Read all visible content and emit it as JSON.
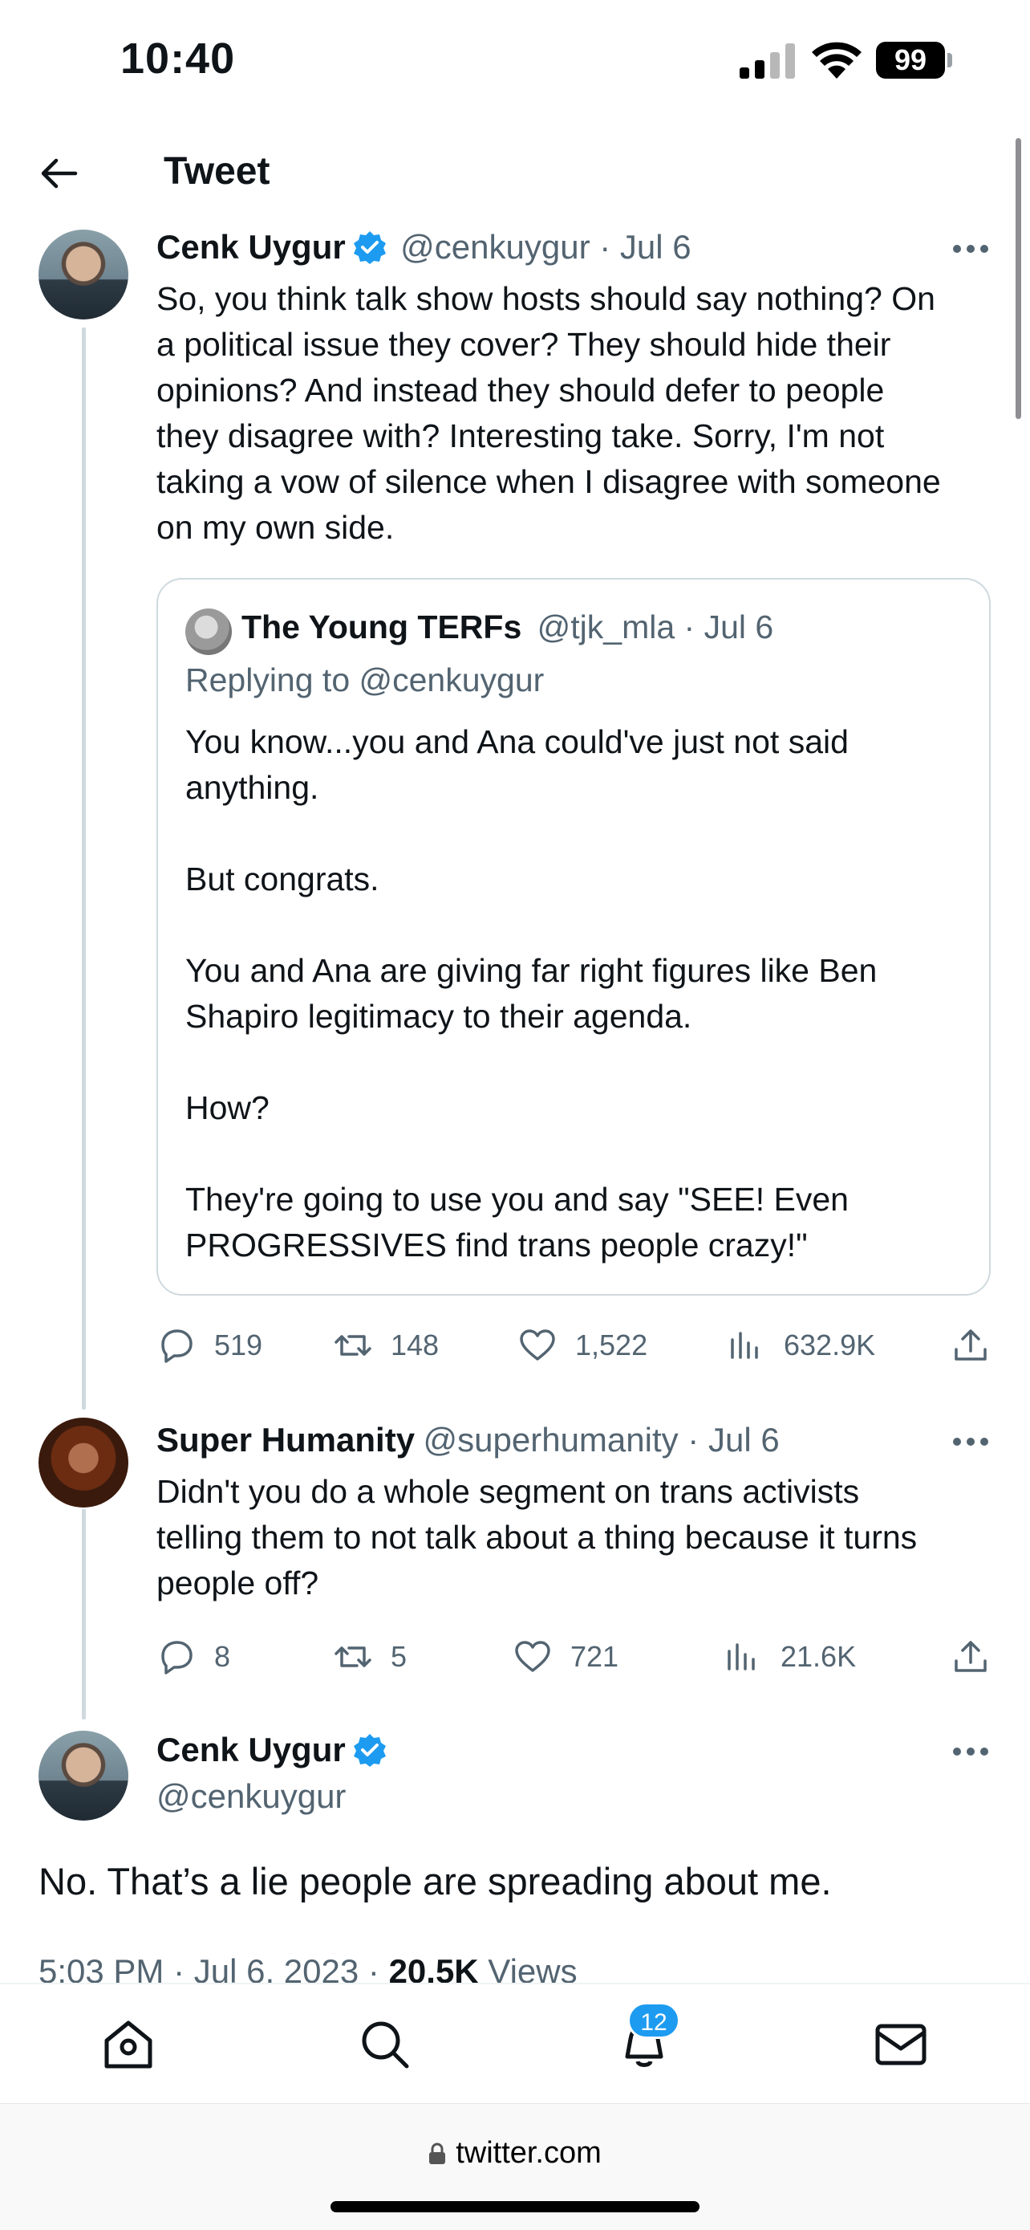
{
  "status_bar": {
    "time": "10:40",
    "battery": "99"
  },
  "header": {
    "title": "Tweet"
  },
  "tweet1": {
    "name": "Cenk Uygur",
    "handle_date": "@cenkuygur · Jul 6",
    "text": "So, you think talk show hosts should say nothing? On\na political issue they cover? They should hide their\nopinions? And instead they should defer to people\nthey disagree with? Interesting take. Sorry, I'm not\ntaking a vow of silence when I disagree with someone\non my own side.",
    "quote": {
      "name": "The Young TERFs",
      "handle_date": "@tjk_mla · Jul 6",
      "replying_to": "Replying to @cenkuygur",
      "text": "You know...you and Ana could've just not said\nanything.\n\nBut congrats.\n\nYou and Ana are giving far right figures like Ben\nShapiro legitimacy to their agenda.\n\nHow?\n\nThey're going to use you and say \"SEE! Even\nPROGRESSIVES find trans people crazy!\""
    },
    "stats": {
      "replies": "519",
      "retweets": "148",
      "likes": "1,522",
      "views": "632.9K"
    }
  },
  "tweet2": {
    "name": "Super Humanity",
    "handle_date": "@superhumanity · Jul 6",
    "text": "Didn't you do a whole segment on trans activists\ntelling them to not talk about a thing because it turns\npeople off?",
    "stats": {
      "replies": "8",
      "retweets": "5",
      "likes": "721",
      "views": "21.6K"
    }
  },
  "main_tweet": {
    "name": "Cenk Uygur",
    "handle": "@cenkuygur",
    "text": "No. That’s a lie people are spreading about me.",
    "time_date": "5:03 PM · Jul 6, 2023 · ",
    "views_count": "20.5K",
    "views_label": " Views"
  },
  "bottom_nav": {
    "notifications_badge": "12"
  },
  "browser": {
    "url": "twitter.com"
  },
  "colors": {
    "accent": "#1d9bf0",
    "secondary_text": "#536471"
  }
}
